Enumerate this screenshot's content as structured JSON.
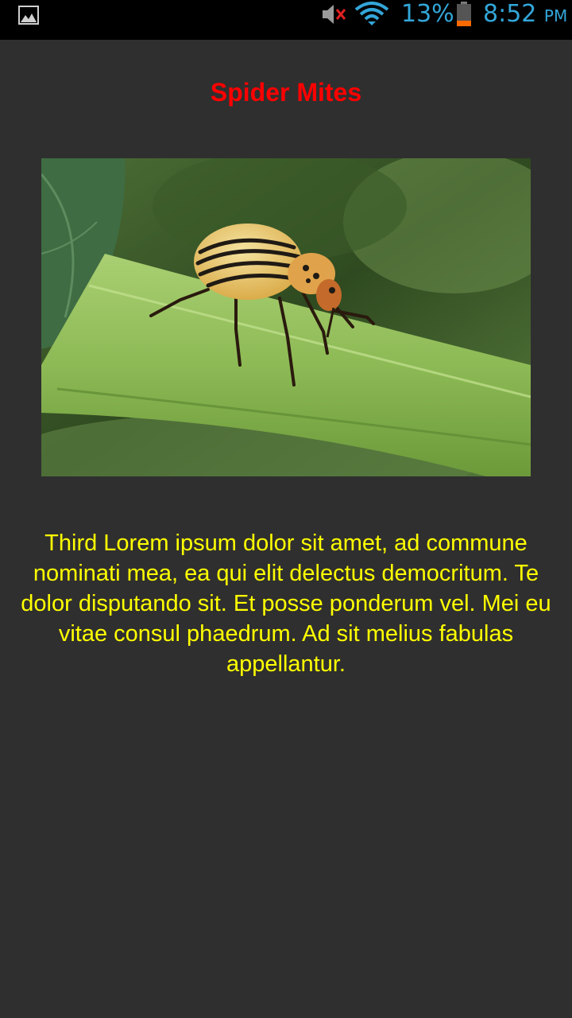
{
  "status_bar": {
    "notification_icon": "gallery-icon",
    "sound_icon": "mute-icon",
    "wifi_icon": "wifi-icon",
    "battery_percent": "13%",
    "battery_icon": "battery-low-icon",
    "time": "8:52",
    "ampm": "PM",
    "text_color": "#33a6d9"
  },
  "content": {
    "title": "Spider Mites",
    "title_color": "#ff0000",
    "image_icon": "beetle-photo",
    "description": "Third Lorem ipsum dolor sit amet, ad commune nominati mea, ea qui elit delectus democritum. Te dolor disputando sit. Et posse ponderum vel. Mei eu vitae consul phaedrum. Ad sit melius fabulas appellantur.",
    "description_color": "#ffff00",
    "background_color": "#2f2f2f"
  }
}
